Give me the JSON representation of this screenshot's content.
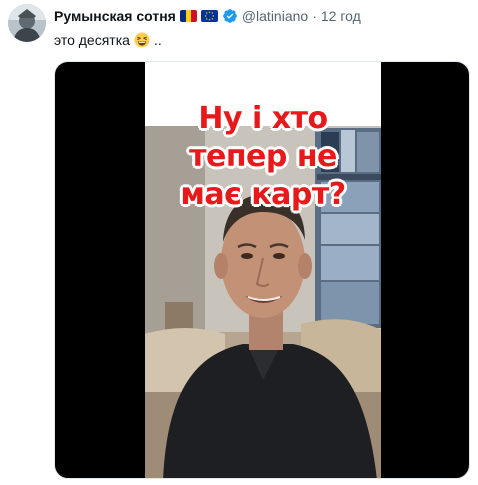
{
  "tweet": {
    "author": {
      "display_name": "Румынская сотня",
      "flags": [
        "romania-flag-icon",
        "eu-flag-icon"
      ],
      "verified": true,
      "handle": "@latiniano",
      "separator": "·",
      "time": "12 год"
    },
    "text": "это десятка",
    "emoji": "grinning-squinting-face-icon",
    "text_suffix": "..",
    "media": {
      "type": "video",
      "caption_lines": [
        "Ну і хто",
        "тепер не",
        "має карт?"
      ]
    }
  },
  "colors": {
    "caption_red": "#e8191b",
    "secondary_text": "#536471",
    "verified_blue": "#1d9bf0",
    "media_background": "#000000"
  }
}
